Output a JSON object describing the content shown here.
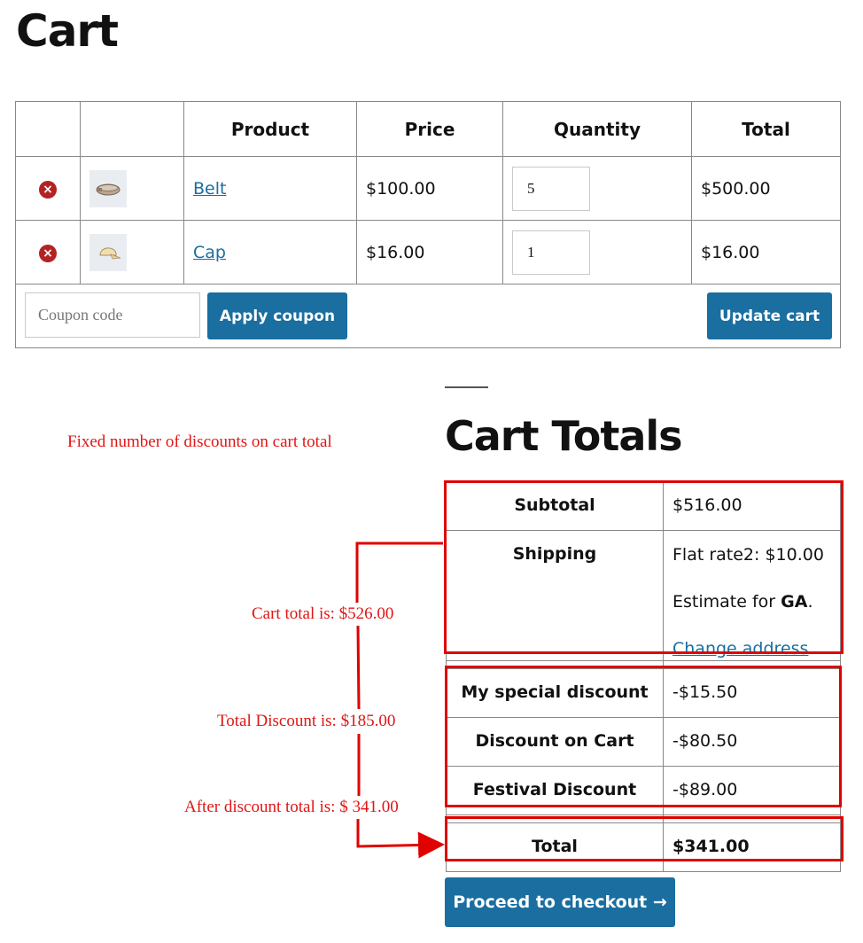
{
  "page_title": "Cart",
  "cart_table": {
    "headers": [
      "",
      "",
      "Product",
      "Price",
      "Quantity",
      "Total"
    ],
    "items": [
      {
        "name": "Belt",
        "price": "$100.00",
        "quantity": "5",
        "total": "$500.00",
        "thumb_icon": "belt-icon"
      },
      {
        "name": "Cap",
        "price": "$16.00",
        "quantity": "1",
        "total": "$16.00",
        "thumb_icon": "cap-icon"
      }
    ],
    "remove_glyph": "×",
    "coupon_placeholder": "Coupon code",
    "apply_coupon_label": "Apply coupon",
    "update_cart_label": "Update cart"
  },
  "cart_totals": {
    "title": "Cart Totals",
    "subtotal_label": "Subtotal",
    "subtotal_value": "$516.00",
    "shipping_label": "Shipping",
    "shipping_rate": "Flat rate2: $10.00",
    "estimate_prefix": "Estimate for ",
    "estimate_state": "GA",
    "estimate_suffix": ".",
    "change_address": "Change address",
    "discounts": [
      {
        "label": "My special discount",
        "value": "-$15.50"
      },
      {
        "label": "Discount on Cart",
        "value": "-$80.50"
      },
      {
        "label": "Festival Discount",
        "value": "-$89.00"
      }
    ],
    "total_label": "Total",
    "total_value": "$341.00",
    "checkout_label": "Proceed to checkout →"
  },
  "annotations": {
    "heading": "Fixed number of discounts on cart total",
    "cart_total": "Cart total is: $526.00",
    "total_discount": "Total Discount is: $185.00",
    "after_discount": "After discount total is: $ 341.00",
    "color": "#e01515"
  },
  "colors": {
    "accent": "#1a6ea0",
    "remove": "#b32222",
    "annotation_red": "#e00000"
  }
}
